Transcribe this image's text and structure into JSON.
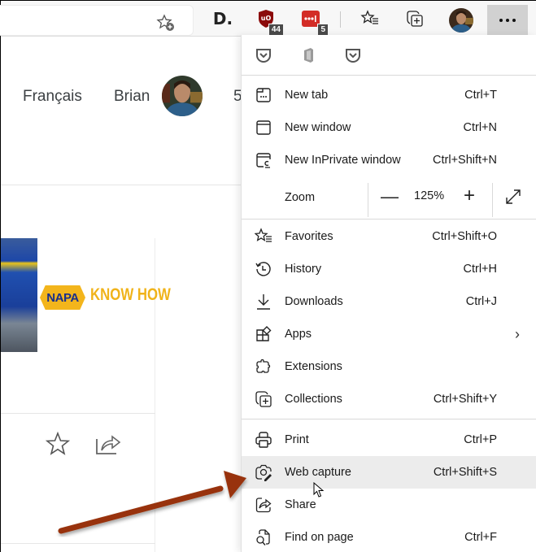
{
  "toolbar": {
    "address_favorite_icon": "add-favorite-icon",
    "extensions": [
      {
        "name": "disqus-extension",
        "glyph": "D."
      },
      {
        "name": "ublock-origin-extension",
        "badge": "44",
        "color": "#800000"
      },
      {
        "name": "lastpass-extension",
        "badge": "5",
        "color": "#d32d27"
      }
    ],
    "favorites_icon": "favorites-icon",
    "collections_icon": "collections-icon",
    "more_label": "..."
  },
  "page": {
    "language_link": "Français",
    "user_name": "Brian",
    "partial_number": "5",
    "ad": {
      "logo_text": "NAPA",
      "tagline": "KNOW HOW",
      "brand_colors": {
        "yellow": "#f3b51c",
        "blue": "#1a2f8a"
      }
    }
  },
  "menu": {
    "top_icons": [
      "pocket-icon",
      "office-icon",
      "pocket-icon"
    ],
    "items": [
      {
        "label": "New tab",
        "shortcut": "Ctrl+T",
        "icon": "new-tab-icon"
      },
      {
        "label": "New window",
        "shortcut": "Ctrl+N",
        "icon": "new-window-icon"
      },
      {
        "label": "New InPrivate window",
        "shortcut": "Ctrl+Shift+N",
        "icon": "inprivate-icon"
      }
    ],
    "zoom": {
      "label": "Zoom",
      "value": "125%",
      "minus": "—",
      "plus": "+"
    },
    "items2": [
      {
        "label": "Favorites",
        "shortcut": "Ctrl+Shift+O",
        "icon": "favorites-icon"
      },
      {
        "label": "History",
        "shortcut": "Ctrl+H",
        "icon": "history-icon"
      },
      {
        "label": "Downloads",
        "shortcut": "Ctrl+J",
        "icon": "download-icon"
      },
      {
        "label": "Apps",
        "shortcut": "",
        "icon": "apps-icon",
        "chevron": "›"
      },
      {
        "label": "Extensions",
        "shortcut": "",
        "icon": "extensions-icon"
      },
      {
        "label": "Collections",
        "shortcut": "Ctrl+Shift+Y",
        "icon": "collections-icon"
      }
    ],
    "items3": [
      {
        "label": "Print",
        "shortcut": "Ctrl+P",
        "icon": "print-icon"
      },
      {
        "label": "Web capture",
        "shortcut": "Ctrl+Shift+S",
        "icon": "web-capture-icon",
        "highlighted": true
      },
      {
        "label": "Share",
        "shortcut": "",
        "icon": "share-icon"
      },
      {
        "label": "Find on page",
        "shortcut": "Ctrl+F",
        "icon": "find-icon"
      }
    ]
  },
  "annotation": {
    "arrow_color": "#9a3412",
    "target": "Web capture"
  }
}
